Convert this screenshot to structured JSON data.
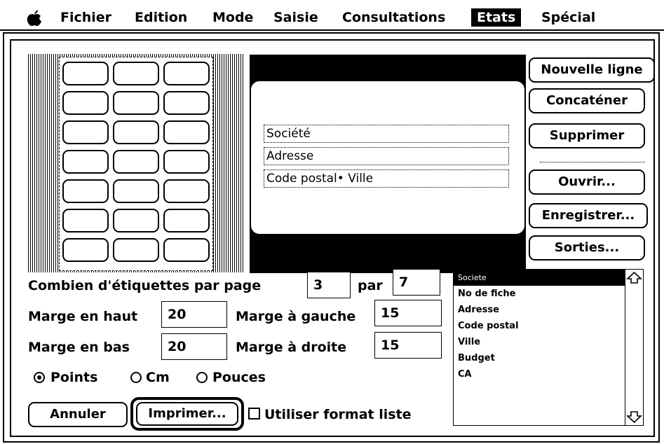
{
  "menubar": {
    "items": [
      "Fichier",
      "Edition",
      "Mode",
      "Saisie",
      "Consultations",
      "Etats",
      "Spécial"
    ],
    "selected": "Etats"
  },
  "editor": {
    "fields": [
      "Société",
      "Adresse",
      "Code postal• Ville"
    ]
  },
  "buttons": {
    "new_line": "Nouvelle ligne",
    "concat": "Concaténer",
    "delete": "Supprimer",
    "open": "Ouvrir...",
    "save": "Enregistrer...",
    "outputs": "Sorties...",
    "cancel": "Annuler",
    "print": "Imprimer..."
  },
  "form": {
    "labels_per_page_label": "Combien d'étiquettes par page",
    "labels_across": "3",
    "par_label": "par",
    "labels_down": "7",
    "top_margin_label": "Marge en haut",
    "top_margin": "20",
    "left_margin_label": "Marge à gauche",
    "left_margin": "15",
    "bottom_margin_label": "Marge en bas",
    "bottom_margin": "20",
    "right_margin_label": "Marge à droite",
    "right_margin": "15"
  },
  "units": {
    "options": [
      "Points",
      "Cm",
      "Pouces"
    ],
    "selected": "Points"
  },
  "list_format": {
    "label": "Utiliser format liste",
    "checked": false
  },
  "field_list": {
    "items": [
      "Societe",
      "No de fiche",
      "Adresse",
      "Code postal",
      "Ville",
      "Budget",
      "CA"
    ],
    "selected": "Societe"
  },
  "sheet": {
    "columns": 3,
    "rows": 7
  },
  "colors": {
    "foreground": "#000000",
    "background": "#ffffff"
  }
}
